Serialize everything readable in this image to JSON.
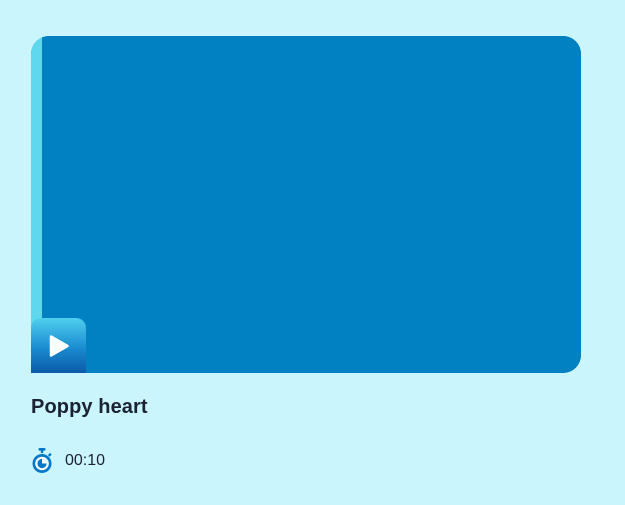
{
  "video": {
    "title": "Poppy heart",
    "duration": "00:10",
    "play_icon": "play-icon",
    "timer_icon": "stopwatch-icon"
  },
  "colors": {
    "background": "#cbf5fd",
    "card": "#0180c2",
    "card_edge": "#5fd8ee",
    "accent": "#0078c8",
    "text": "#1a2233"
  }
}
